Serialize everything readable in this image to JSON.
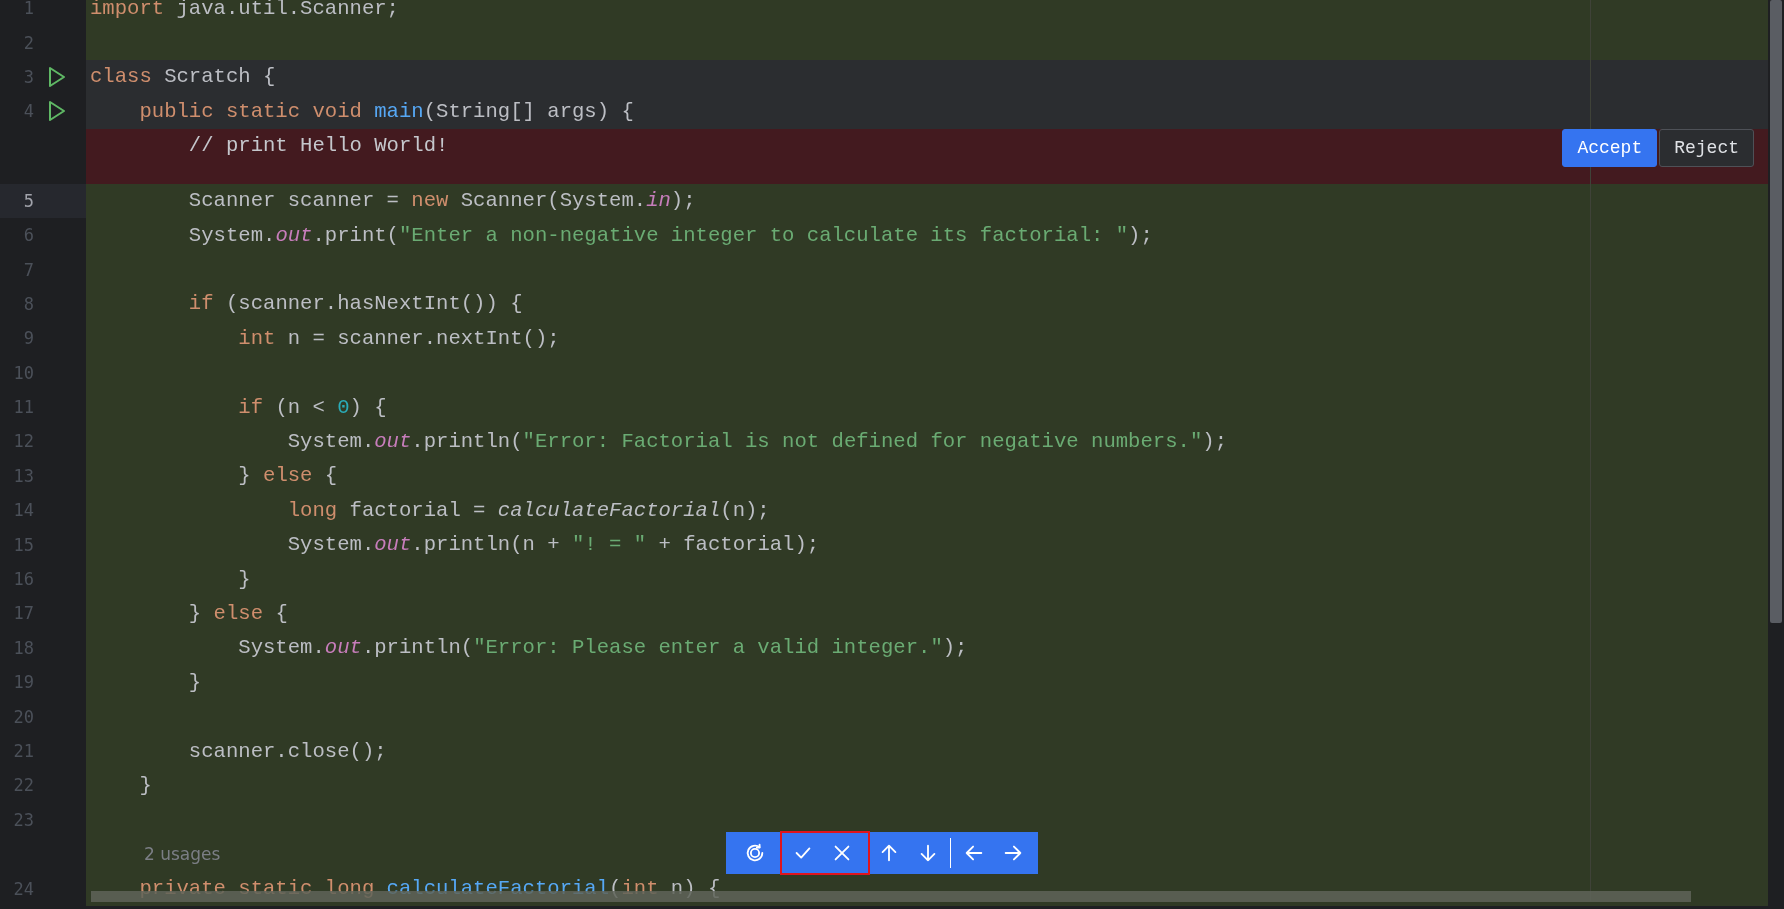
{
  "editor": {
    "rows": [
      {
        "kind": "added",
        "number": "1",
        "current": false,
        "run_marker": false,
        "tokens": [
          {
            "kind": "keyword",
            "text": "import"
          },
          {
            "kind": "plain",
            "text": " java.util.Scanner;"
          }
        ]
      },
      {
        "kind": "added",
        "number": "2",
        "current": false,
        "run_marker": false
      },
      {
        "kind": "unchanged",
        "number": "3",
        "current": false,
        "run_marker": true,
        "tokens": [
          {
            "kind": "keyword",
            "text": "class"
          },
          {
            "kind": "plain",
            "text": " Scratch {"
          }
        ]
      },
      {
        "kind": "unchanged",
        "number": "4",
        "current": false,
        "run_marker": true,
        "tokens": [
          {
            "kind": "keyword",
            "text": "    public static void "
          },
          {
            "kind": "method",
            "text": "main"
          },
          {
            "kind": "plain",
            "text": "(String[] args) {"
          }
        ]
      },
      {
        "kind": "deleted",
        "tokens": [
          {
            "kind": "comment",
            "text": "        // print Hello World!"
          }
        ],
        "actions": [
          {
            "label": "Accept",
            "primary": true
          },
          {
            "label": "Reject",
            "primary": false
          }
        ]
      },
      {
        "kind": "added",
        "number": "5",
        "current": true,
        "run_marker": false,
        "tokens": [
          {
            "kind": "plain",
            "text": "        Scanner scanner = "
          },
          {
            "kind": "keyword",
            "text": "new"
          },
          {
            "kind": "plain",
            "text": " Scanner(System."
          },
          {
            "kind": "field",
            "text": "in"
          },
          {
            "kind": "plain",
            "text": ");"
          }
        ]
      },
      {
        "kind": "added",
        "number": "6",
        "current": false,
        "run_marker": false,
        "tokens": [
          {
            "kind": "plain",
            "text": "        System."
          },
          {
            "kind": "field",
            "text": "out"
          },
          {
            "kind": "plain",
            "text": ".print("
          },
          {
            "kind": "string",
            "text": "\"Enter a non-negative integer to calculate its factorial: \""
          },
          {
            "kind": "plain",
            "text": ");"
          }
        ]
      },
      {
        "kind": "added",
        "number": "7",
        "current": false,
        "run_marker": false
      },
      {
        "kind": "added",
        "number": "8",
        "current": false,
        "run_marker": false,
        "tokens": [
          {
            "kind": "keyword",
            "text": "        if"
          },
          {
            "kind": "plain",
            "text": " (scanner.hasNextInt()) {"
          }
        ]
      },
      {
        "kind": "added",
        "number": "9",
        "current": false,
        "run_marker": false,
        "tokens": [
          {
            "kind": "keyword",
            "text": "            int"
          },
          {
            "kind": "plain",
            "text": " n = scanner.nextInt();"
          }
        ]
      },
      {
        "kind": "added",
        "number": "10",
        "current": false,
        "run_marker": false
      },
      {
        "kind": "added",
        "number": "11",
        "current": false,
        "run_marker": false,
        "tokens": [
          {
            "kind": "keyword",
            "text": "            if"
          },
          {
            "kind": "plain",
            "text": " (n < "
          },
          {
            "kind": "number",
            "text": "0"
          },
          {
            "kind": "plain",
            "text": ") {"
          }
        ]
      },
      {
        "kind": "added",
        "number": "12",
        "current": false,
        "run_marker": false,
        "tokens": [
          {
            "kind": "plain",
            "text": "                System."
          },
          {
            "kind": "field",
            "text": "out"
          },
          {
            "kind": "plain",
            "text": ".println("
          },
          {
            "kind": "string",
            "text": "\"Error: Factorial is not defined for negative numbers.\""
          },
          {
            "kind": "plain",
            "text": ");"
          }
        ]
      },
      {
        "kind": "added",
        "number": "13",
        "current": false,
        "run_marker": false,
        "tokens": [
          {
            "kind": "plain",
            "text": "            } "
          },
          {
            "kind": "keyword",
            "text": "else"
          },
          {
            "kind": "plain",
            "text": " {"
          }
        ]
      },
      {
        "kind": "added",
        "number": "14",
        "current": false,
        "run_marker": false,
        "tokens": [
          {
            "kind": "keyword",
            "text": "                long"
          },
          {
            "kind": "plain",
            "text": " factorial = "
          },
          {
            "kind": "static_call",
            "text": "calculateFactorial"
          },
          {
            "kind": "plain",
            "text": "(n);"
          }
        ]
      },
      {
        "kind": "added",
        "number": "15",
        "current": false,
        "run_marker": false,
        "tokens": [
          {
            "kind": "plain",
            "text": "                System."
          },
          {
            "kind": "field",
            "text": "out"
          },
          {
            "kind": "plain",
            "text": ".println(n + "
          },
          {
            "kind": "string",
            "text": "\"! = \""
          },
          {
            "kind": "plain",
            "text": " + factorial);"
          }
        ]
      },
      {
        "kind": "added",
        "number": "16",
        "current": false,
        "run_marker": false,
        "tokens": [
          {
            "kind": "plain",
            "text": "            }"
          }
        ]
      },
      {
        "kind": "added",
        "number": "17",
        "current": false,
        "run_marker": false,
        "tokens": [
          {
            "kind": "plain",
            "text": "        } "
          },
          {
            "kind": "keyword",
            "text": "else"
          },
          {
            "kind": "plain",
            "text": " {"
          }
        ]
      },
      {
        "kind": "added",
        "number": "18",
        "current": false,
        "run_marker": false,
        "tokens": [
          {
            "kind": "plain",
            "text": "            System."
          },
          {
            "kind": "field",
            "text": "out"
          },
          {
            "kind": "plain",
            "text": ".println("
          },
          {
            "kind": "string",
            "text": "\"Error: Please enter a valid integer.\""
          },
          {
            "kind": "plain",
            "text": ");"
          }
        ]
      },
      {
        "kind": "added",
        "number": "19",
        "current": false,
        "run_marker": false,
        "tokens": [
          {
            "kind": "plain",
            "text": "        }"
          }
        ]
      },
      {
        "kind": "added",
        "number": "20",
        "current": false,
        "run_marker": false
      },
      {
        "kind": "added",
        "number": "21",
        "current": false,
        "run_marker": false,
        "tokens": [
          {
            "kind": "plain",
            "text": "        scanner.close();"
          }
        ]
      },
      {
        "kind": "added",
        "number": "22",
        "current": false,
        "run_marker": false,
        "tokens": [
          {
            "kind": "plain",
            "text": "    }"
          }
        ]
      },
      {
        "kind": "added",
        "number": "23",
        "current": false,
        "run_marker": false
      },
      {
        "kind": "hint",
        "text": "2 usages"
      },
      {
        "kind": "added",
        "number": "24",
        "current": false,
        "run_marker": false,
        "tokens": [
          {
            "kind": "keyword",
            "text": "    private static long "
          },
          {
            "kind": "method",
            "text": "calculateFactorial"
          },
          {
            "kind": "plain",
            "text": "("
          },
          {
            "kind": "keyword",
            "text": "int"
          },
          {
            "kind": "plain",
            "text": " n) {"
          }
        ]
      }
    ]
  }
}
